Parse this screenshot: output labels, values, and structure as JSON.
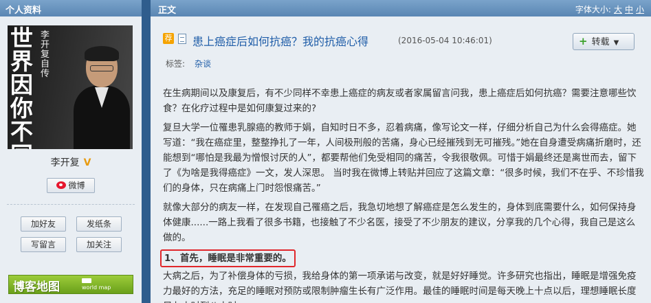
{
  "left_panel": {
    "header": "个人资料",
    "book_cover": {
      "title_big": "世界因你不同",
      "subtitle": "李开复自传"
    },
    "user_name": "李开复",
    "verified_badge": "V",
    "weibo_button": "微博",
    "actions": [
      "加好友",
      "发纸条",
      "写留言",
      "加关注"
    ],
    "blog_map": {
      "title": "博客地图",
      "subtitle": "world map"
    }
  },
  "main": {
    "header": "正文",
    "font_size": {
      "label": "字体大小:",
      "options": [
        "大",
        "中",
        "小"
      ]
    },
    "article": {
      "recommend_badge": "荐",
      "title": "患上癌症后如何抗癌？我的抗癌心得",
      "date": "(2016-05-04 10:46:01)",
      "repost_button": "转载",
      "tags_label": "标签:",
      "tag": "杂谈",
      "paragraphs": [
        "在生病期间以及康复后，有不少同样不幸患上癌症的病友或者家属留言问我，患上癌症后如何抗癌？需要注意哪些饮食？在化疗过程中是如何康复过来的?",
        "复旦大学一位罹患乳腺癌的教师于娟，自知时日不多，忍着病痛，像写论文一样，仔细分析自己为什么会得癌症。她写道：“我在癌症里，整整挣扎了一年，人间极刑般的苦痛，身心已经摧残到无可摧残。”她在自身遭受病痛折磨时，还能想到“哪怕是我最为憎恨讨厌的人”，都要帮他们免受相同的痛苦，令我很敬佩。可惜于娟最终还是离世而去，留下了《为啥是我得癌症》一文，发人深思。 当时我在微博上转贴并回应了这篇文章：“很多时候，我们不在乎、不珍惜我们的身体，只在病痛上门时怨恨痛苦。”",
        "就像大部分的病友一样，在发现自己罹癌之后，我急切地想了解癌症是怎么发生的，身体到底需要什么，如何保持身体健康......一路上我看了很多书籍，也接触了不少名医，接受了不少朋友的建议，分享我的几个心得，我自己是这么做的。"
      ],
      "highlight": "1、首先，睡眠是非常重要的。",
      "last_paragraph": "大病之后，为了补偿身体的亏损，我给身体的第一项承诺与改变，就是好好睡觉。许多研究也指出，睡眠是增强免疫力最好的方法，充足的睡眠对预防或限制肿瘤生长有广泛作用。最佳的睡眠时间是每天晚上十点以后，理想睡眠长度是七小时到八小时。"
    }
  },
  "colors": {
    "frame_blue": "#2f5d8d",
    "panel_bg": "#e9eef3",
    "title_blue": "#1f5da8",
    "highlight_red": "#e0262a"
  }
}
